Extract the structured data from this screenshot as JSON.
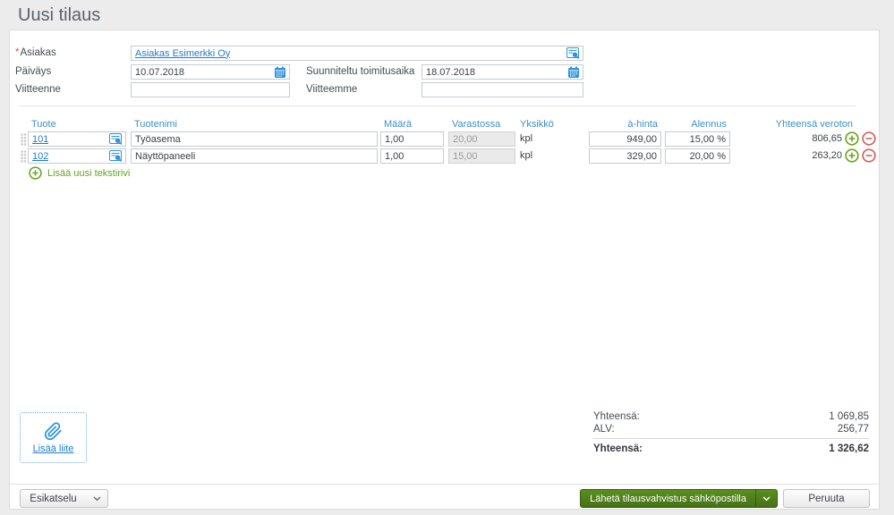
{
  "page": {
    "title": "Uusi tilaus"
  },
  "colors": {
    "accent_blue": "#2e93dc",
    "link_blue": "#1e7ec9",
    "header_blue": "#3f8fca",
    "success_green": "#61a51f",
    "danger_red": "#d4605c",
    "button_green": "#4c7a17",
    "page_background": "#ececec"
  },
  "icons": {
    "customer_lookup": "card-magnifier",
    "product_lookup": "card-magnifier",
    "date_picker": "calendar",
    "add": "plus-circle",
    "remove": "minus-circle",
    "attachment": "paperclip",
    "dropdown": "chevron-down",
    "row_drag": "grip-dots"
  },
  "form": {
    "customer": {
      "label": "Asiakas",
      "required_mark": "*",
      "value": "Asiakas Esimerkki Oy"
    },
    "date": {
      "label": "Päiväys",
      "value": "10.07.2018"
    },
    "delivery": {
      "label": "Suunniteltu toimitusaika",
      "value": "18.07.2018"
    },
    "your_reference": {
      "label": "Viitteenne",
      "value": ""
    },
    "our_reference": {
      "label": "Viitteemme",
      "value": ""
    }
  },
  "table": {
    "headers": {
      "product": "Tuote",
      "name": "Tuotenimi",
      "quantity": "Määrä",
      "stock": "Varastossa",
      "unit": "Yksikkö",
      "price": "à-hinta",
      "discount": "Alennus",
      "total": "Yhteensä veroton"
    },
    "rows": [
      {
        "product": "101",
        "name": "Työasema",
        "quantity": "1,00",
        "stock": "20,00",
        "unit": "kpl",
        "price": "949,00",
        "discount": "15,00 %",
        "total": "806,65"
      },
      {
        "product": "102",
        "name": "Näyttöpaneeli",
        "quantity": "1,00",
        "stock": "15,00",
        "unit": "kpl",
        "price": "329,00",
        "discount": "20,00 %",
        "total": "263,20"
      }
    ],
    "add_text_row_label": "Lisää uusi tekstirivi"
  },
  "attachment": {
    "label": "Lisää liite"
  },
  "totals": {
    "subtotal_label": "Yhteensä:",
    "subtotal_value": "1 069,85",
    "vat_label": "ALV:",
    "vat_value": "256,77",
    "total_label": "Yhteensä:",
    "total_value": "1 326,62"
  },
  "footer": {
    "preview_label": "Esikatselu",
    "send_label": "Lähetä tilausvahvistus sähköpostilla",
    "cancel_label": "Peruuta"
  }
}
